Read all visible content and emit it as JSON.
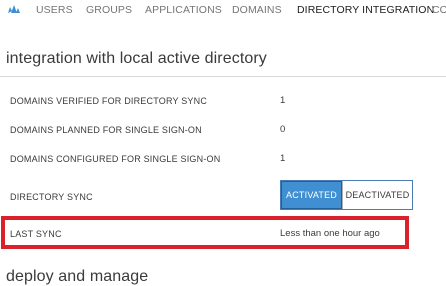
{
  "nav": {
    "items": [
      {
        "label": "USERS"
      },
      {
        "label": "GROUPS"
      },
      {
        "label": "APPLICATIONS"
      },
      {
        "label": "DOMAINS"
      },
      {
        "label": "DIRECTORY INTEGRATION"
      },
      {
        "label": "CO"
      }
    ],
    "active_index": 4,
    "icon": "cloud-people-icon",
    "accent_color": "#3f8fd2"
  },
  "integration": {
    "title": "integration with local active directory",
    "rows": [
      {
        "label": "DOMAINS VERIFIED FOR DIRECTORY SYNC",
        "value": "1"
      },
      {
        "label": "DOMAINS PLANNED FOR SINGLE SIGN-ON",
        "value": "0"
      },
      {
        "label": "DOMAINS CONFIGURED FOR SINGLE SIGN-ON",
        "value": "1"
      }
    ],
    "directory_sync": {
      "label": "DIRECTORY SYNC",
      "activated_label": "ACTIVATED",
      "deactivated_label": "DEACTIVATED",
      "selected": "ACTIVATED"
    },
    "last_sync": {
      "label": "LAST SYNC",
      "value": "Less than one hour ago",
      "highlight_color": "#d9222b"
    }
  },
  "deploy": {
    "title": "deploy and manage"
  }
}
